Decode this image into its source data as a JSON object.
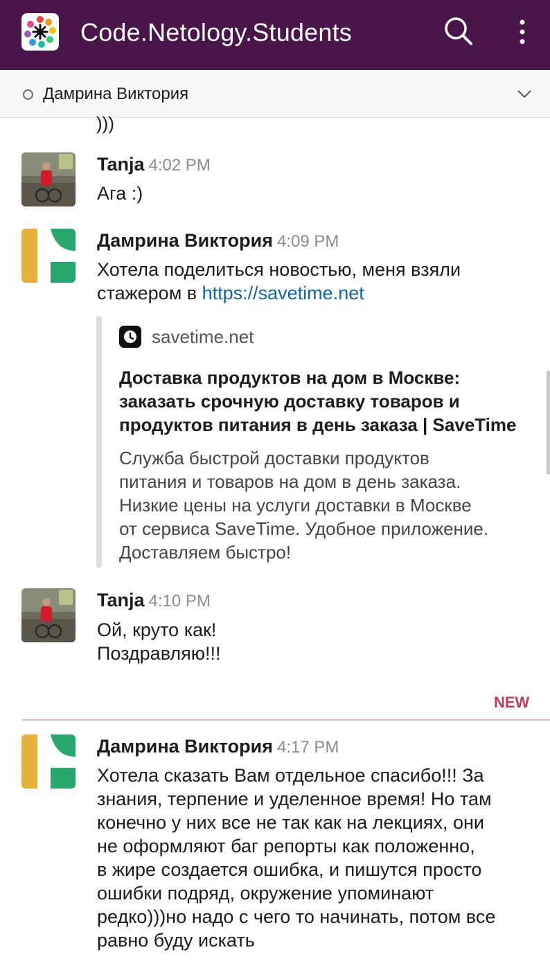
{
  "app": {
    "title": "Code.Netology.Students",
    "logo_icon": "workspace-logo-icon",
    "header_color": "#4a154b"
  },
  "header": {
    "search_icon": "search-icon",
    "menu_icon": "more-vertical-icon"
  },
  "channel": {
    "name": "Дамрина Виктория",
    "presence_icon": "presence-away-icon",
    "dropdown_icon": "chevron-down-icon"
  },
  "previous_fragment": ")))",
  "messages": [
    {
      "author": "Tanja",
      "time": "4:02 PM",
      "lines": [
        "Ага :)"
      ]
    },
    {
      "author": "Дамрина Виктория",
      "time": "4:09 PM",
      "text_prefix": "Хотела поделиться новостью, меня взяли",
      "text_line2": "стажером в ",
      "link": "https://savetime.net",
      "unfurl": {
        "site": "savetime.net",
        "title_lines": [
          "Доставка продуктов на дом в Москве:",
          "заказать срочную доставку товаров и",
          "продуктов питания в день заказа | SaveTime"
        ],
        "desc_lines": [
          "Служба быстрой доставки продуктов",
          "питания и товаров на дом в день заказа.",
          "Низкие цены на услуги доставки в Москве",
          "от сервиса SaveTime. Удобное приложение.",
          "Доставляем быстро!"
        ]
      }
    },
    {
      "author": "Tanja",
      "time": "4:10 PM",
      "lines": [
        "Ой, круто как!",
        "Поздравляю!!!"
      ]
    },
    {
      "author": "Дамрина Виктория",
      "time": "4:17 PM",
      "lines": [
        "Хотела сказать Вам отдельное спасибо!!! За",
        "знания, терпение и уделенное время! Но там",
        "конечно у них все не так как на лекциях, они",
        "не оформляют баг репорты как положенно,",
        "в жире создается ошибка, и пишутся просто",
        "ошибки подряд, окружение упоминают",
        "редко)))но надо с чего то начинать, потом все",
        "равно буду искать"
      ]
    }
  ],
  "new_divider": {
    "label": "NEW",
    "color": "#c0395f"
  },
  "link_color": "#1264a3"
}
